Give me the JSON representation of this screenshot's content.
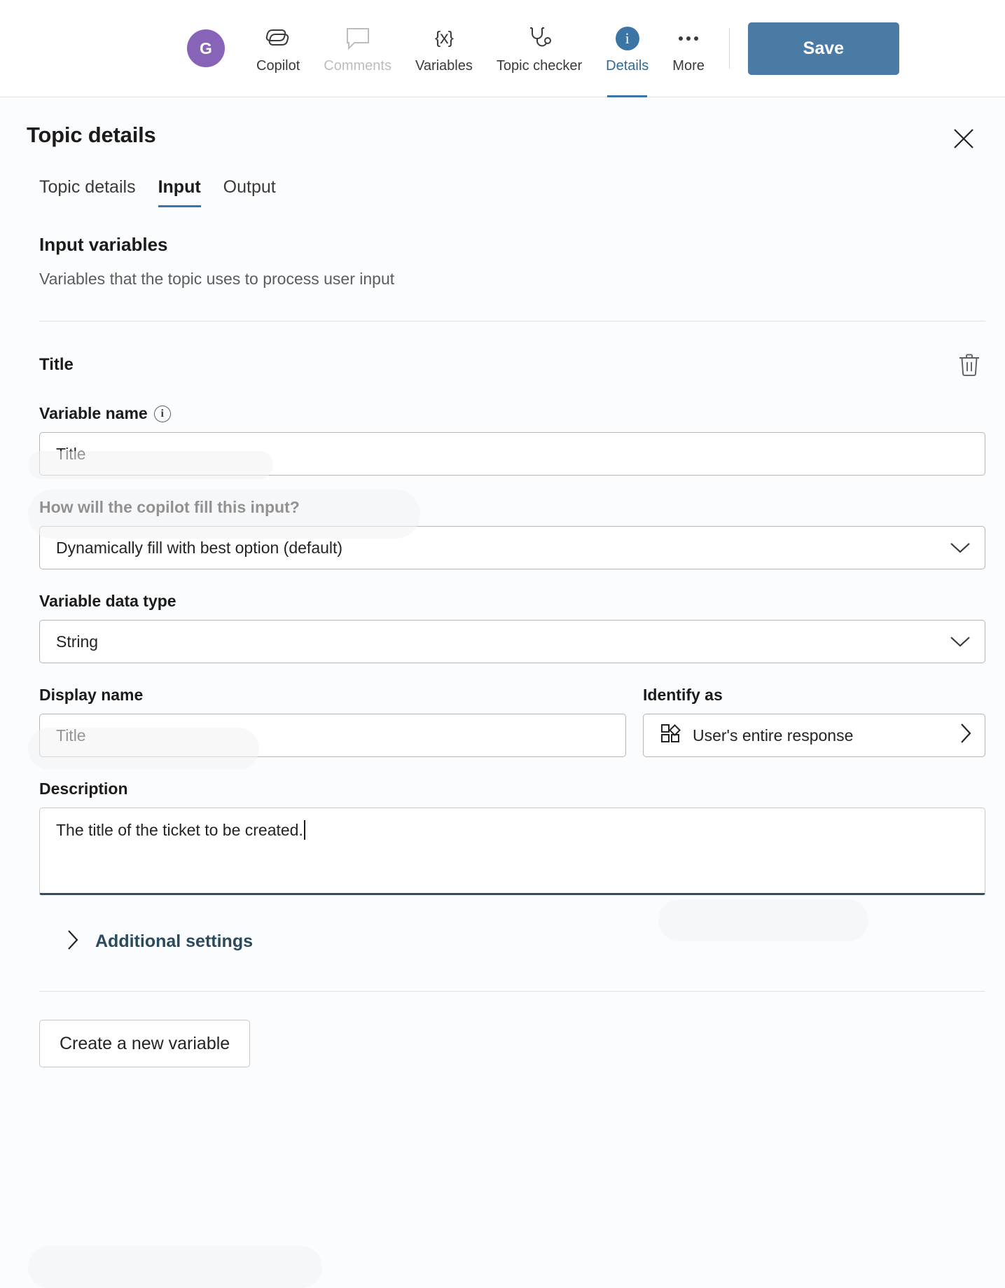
{
  "toolbar": {
    "avatar_initial": "G",
    "items": [
      {
        "label": "Copilot",
        "icon": "copilot-icon",
        "state": "normal"
      },
      {
        "label": "Comments",
        "icon": "comment-icon",
        "state": "disabled"
      },
      {
        "label": "Variables",
        "icon": "variables-icon",
        "state": "normal"
      },
      {
        "label": "Topic checker",
        "icon": "stethoscope-icon",
        "state": "normal"
      },
      {
        "label": "Details",
        "icon": "info-circle-icon",
        "state": "active"
      },
      {
        "label": "More",
        "icon": "ellipsis-icon",
        "state": "normal"
      }
    ],
    "save_label": "Save",
    "accent_blue": "#4a7ba5",
    "avatar_color": "#8764b8",
    "active_tab_color": "#2f6b9a"
  },
  "panel": {
    "title": "Topic details",
    "close_icon": "close-icon",
    "tabs": [
      {
        "label": "Topic details",
        "active": false
      },
      {
        "label": "Input",
        "active": true
      },
      {
        "label": "Output",
        "active": false
      }
    ],
    "section": {
      "heading": "Input variables",
      "subheading": "Variables that the topic uses to process user input"
    },
    "variable": {
      "name": "Title",
      "delete_icon": "trash-icon",
      "fields": {
        "variable_name_label": "Variable name",
        "variable_name_info_icon": "info-icon",
        "variable_name_value": "Title",
        "fill_label": "How will the copilot fill this input?",
        "fill_value": "Dynamically fill with best option (default)",
        "data_type_label": "Variable data type",
        "data_type_value": "String",
        "display_name_label": "Display name",
        "display_name_value": "Title",
        "identify_as_label": "Identify as",
        "identify_as_value": "User's entire response",
        "identify_as_icon": "entity-grid-icon",
        "description_label": "Description",
        "description_value": "The title of the ticket to be created."
      },
      "additional_settings_label": "Additional settings",
      "additional_settings_icon": "chevron-right-icon"
    },
    "create_variable_label": "Create a new variable"
  }
}
